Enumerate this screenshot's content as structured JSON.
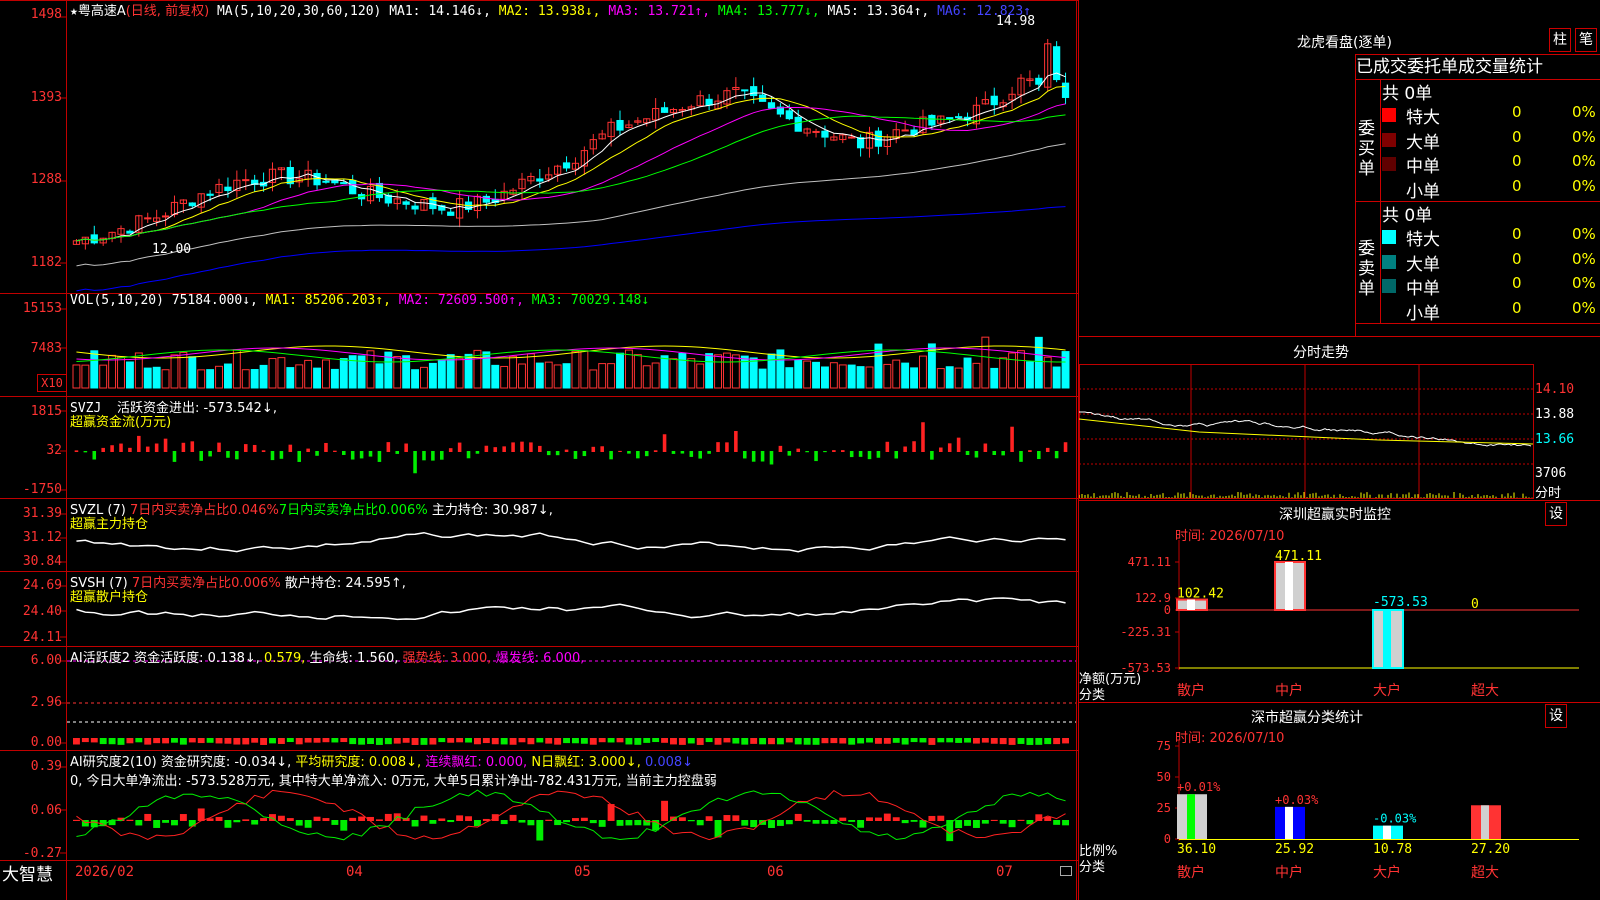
{
  "colors": {
    "up": "#ff3333",
    "down": "#00ffff",
    "grid": "#c00000",
    "ma1": "#ffffff",
    "ma2": "#ffff00",
    "ma3": "#ff00ff",
    "ma4": "#00ff00",
    "ma5": "#c0c0c0",
    "ma6": "#0000ff"
  },
  "main": {
    "star": "★",
    "name": "粤高速A",
    "mode": "(日线, 前复权)",
    "ma_def": "MA(5,10,20,30,60,120)",
    "ma1": "MA1: 14.146↓,",
    "ma2": "MA2: 13.938↓,",
    "ma3": "MA3: 13.721↑,",
    "ma4": "MA4: 13.777↓,",
    "ma5": "MA5: 13.364↑,",
    "ma6": "MA6: 12.823↑",
    "y_labels": [
      "1498",
      "1393",
      "1288",
      "1182"
    ],
    "high_label": "14.98",
    "low_label": "12.00"
  },
  "vol": {
    "title": "VOL(5,10,20)",
    "v": "75184.000↓,",
    "ma1": "MA1: 85206.203↑,",
    "ma2": "MA2: 72609.500↑,",
    "ma3": "MA3: 70029.148↓",
    "y_labels": [
      "15153",
      "7483"
    ],
    "unit": "X10"
  },
  "svzj": {
    "title": "SVZJ",
    "text": "活跃资金进出: -573.542↓,",
    "sub": "超赢资金流(万元)",
    "y_labels": [
      "1815",
      "32",
      "-1750"
    ]
  },
  "svzl": {
    "title": "SVZL (7)",
    "t1": "7日内买卖净占比0.046%",
    "t2": "7日内买卖净占比0.006%",
    "t3": "主力持仓: 30.987↓,",
    "sub": "超赢主力持仓",
    "y_labels": [
      "31.39",
      "31.12",
      "30.84"
    ]
  },
  "svsh": {
    "title": "SVSH (7)",
    "t1": "7日内买卖净占比0.006%",
    "t2": "散户持仓: 24.595↑,",
    "sub": "超赢散户持仓",
    "y_labels": [
      "24.69",
      "24.40",
      "24.11"
    ]
  },
  "ai1": {
    "title": "AI活跃度2",
    "t1": "资金活跃度: 0.138↓,",
    "t2": "0.579,",
    "t3": "生命线: 1.560,",
    "t4": "强势线: 3.000,",
    "t5": "爆发线: 6.000,",
    "y_labels": [
      "6.00",
      "2.96",
      "0.00"
    ]
  },
  "ai2": {
    "title": "AI研究度2(10)",
    "t1": "资金研究度: -0.034↓,",
    "t2": "平均研究度: 0.008↓,",
    "t3": "连续飘红: 0.000,",
    "t4": "N日飘红: 3.000↓,",
    "t5": "0.008↓",
    "line2": "0, 今日大单净流出: -573.528万元, 其中特大单净流入: 0万元, 大单5日累计净出-782.431万元, 当前主力控盘弱",
    "y_labels": [
      "0.39",
      "0.06",
      "-0.27"
    ]
  },
  "xaxis": {
    "labels": [
      "2026/02",
      "04",
      "05",
      "06",
      "07"
    ]
  },
  "brand": "大智慧",
  "dragon": {
    "title": "龙虎看盘(逐单)",
    "btn1": "柱",
    "btn2": "笔",
    "tabs": "已成交委托单成交量统计",
    "buy_label": "委买单",
    "sell_label": "委卖单",
    "buy_total": "共 0单",
    "sell_total": "共 0单",
    "buy_rows": [
      {
        "label": "特大",
        "count": "0",
        "pct": "0%"
      },
      {
        "label": "大单",
        "count": "0",
        "pct": "0%"
      },
      {
        "label": "中单",
        "count": "0",
        "pct": "0%"
      },
      {
        "label": "小单",
        "count": "0",
        "pct": "0%"
      }
    ],
    "sell_rows": [
      {
        "label": "特大",
        "count": "0",
        "pct": "0%"
      },
      {
        "label": "大单",
        "count": "0",
        "pct": "0%"
      },
      {
        "label": "中单",
        "count": "0",
        "pct": "0%"
      },
      {
        "label": "小单",
        "count": "0",
        "pct": "0%"
      }
    ]
  },
  "intraday": {
    "title": "分时走势",
    "y_labels": [
      "14.10",
      "13.88",
      "13.66",
      "3706"
    ],
    "vol_unit": "分时"
  },
  "sz_monitor": {
    "title": "深圳超赢实时监控",
    "btn": "设",
    "time": "时间: 2026/07/10",
    "y_labels": [
      "471.11",
      "122.9",
      "0",
      "-225.31",
      "-573.53"
    ],
    "bar_values": [
      "102.42",
      "471.11",
      "-573.53",
      "0"
    ],
    "cats": [
      "散户",
      "中户",
      "大户",
      "超大"
    ],
    "ylab1": "净额(万元)",
    "ylab2": "分类"
  },
  "sz_stats": {
    "title": "深市超赢分类统计",
    "btn": "设",
    "time": "时间: 2026/07/10",
    "y_labels": [
      "75",
      "50",
      "25",
      "0"
    ],
    "pct": [
      "+0.01%",
      "+0.03%",
      "-0.03%",
      ""
    ],
    "vals": [
      "36.10",
      "25.92",
      "10.78",
      "27.20"
    ],
    "cats": [
      "散户",
      "中户",
      "大户",
      "超大"
    ],
    "ylab1": "比例%",
    "ylab2": "分类"
  }
}
